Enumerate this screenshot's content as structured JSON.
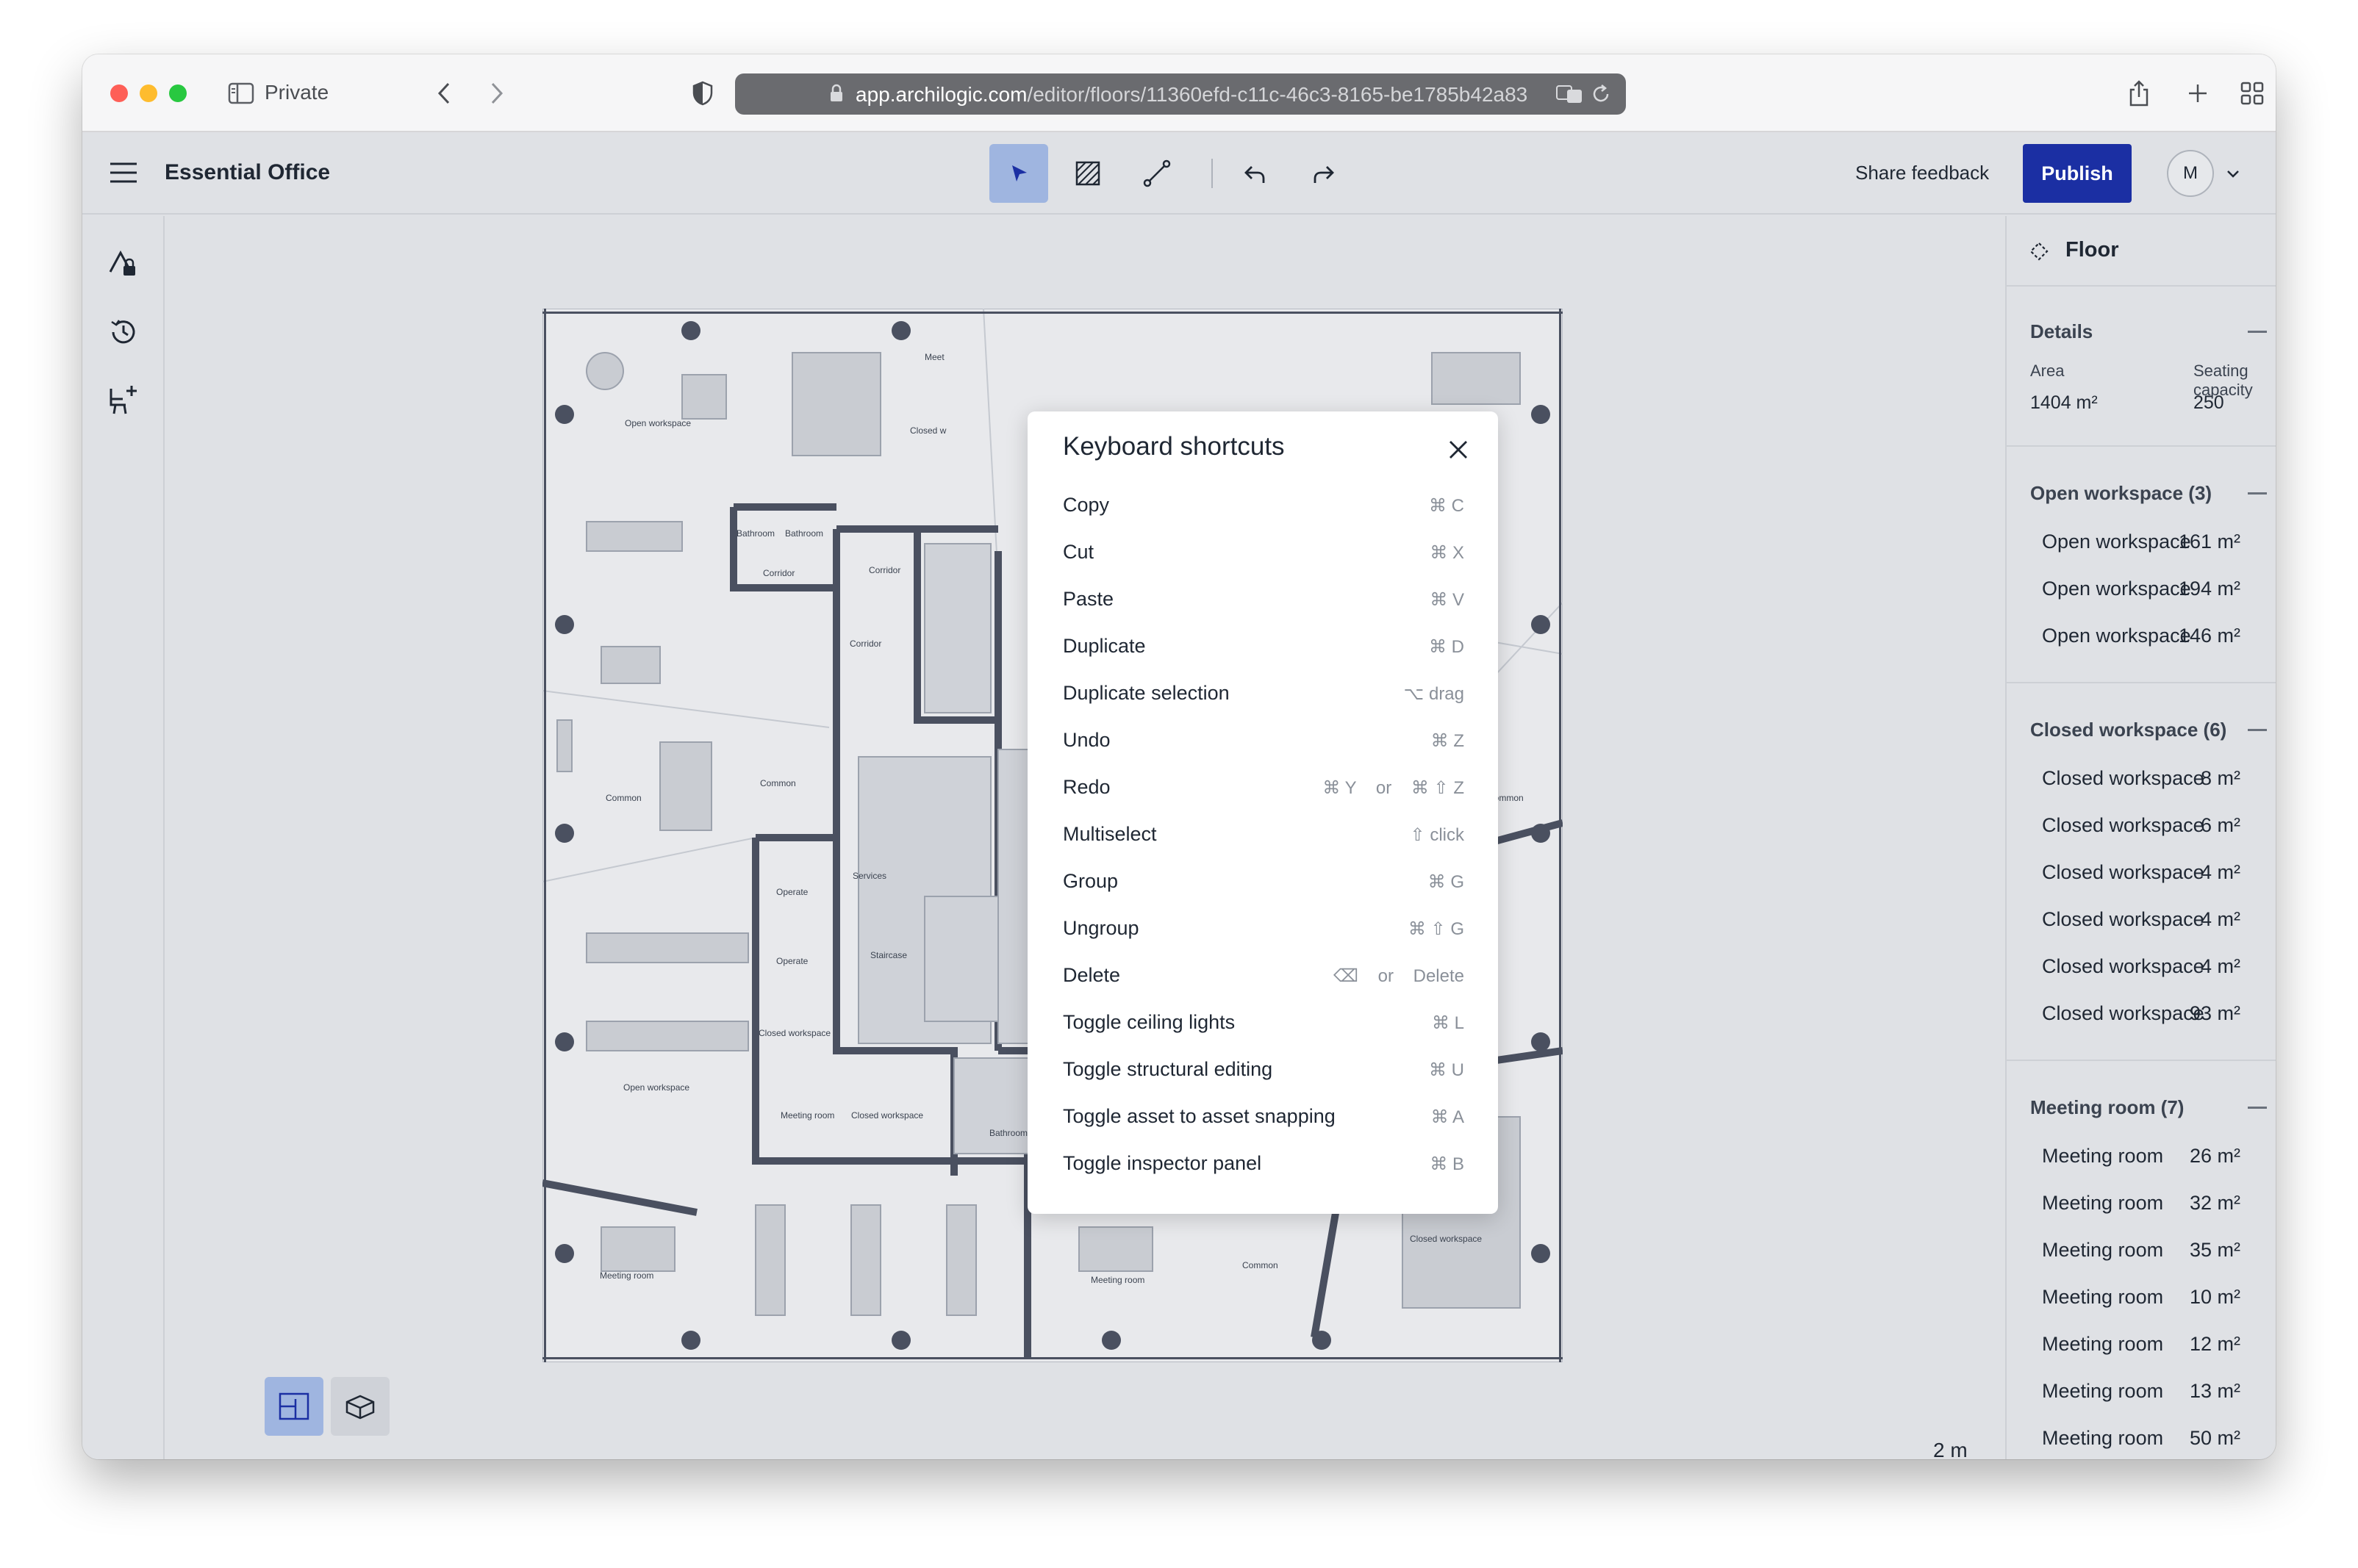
{
  "browser": {
    "private_label": "Private",
    "url_host": "app.archilogic.com",
    "url_path": "/editor/floors/11360efd-c11c-46c3-8165-be1785b42a83"
  },
  "app": {
    "title": "Essential Office",
    "share_feedback": "Share feedback",
    "publish": "Publish",
    "avatar_initial": "M"
  },
  "modal": {
    "title": "Keyboard shortcuts",
    "shortcuts": [
      {
        "label": "Copy",
        "keys": "⌘ C"
      },
      {
        "label": "Cut",
        "keys": "⌘ X"
      },
      {
        "label": "Paste",
        "keys": "⌘ V"
      },
      {
        "label": "Duplicate",
        "keys": "⌘ D"
      },
      {
        "label": "Duplicate selection",
        "keys": "⌥ drag"
      },
      {
        "label": "Undo",
        "keys": "⌘ Z"
      },
      {
        "label": "Redo",
        "keys": "⌘ Y    or    ⌘ ⇧ Z"
      },
      {
        "label": "Multiselect",
        "keys": "⇧ click"
      },
      {
        "label": "Group",
        "keys": "⌘ G"
      },
      {
        "label": "Ungroup",
        "keys": "⌘ ⇧ G"
      },
      {
        "label": "Delete",
        "keys": "⌫    or    Delete"
      },
      {
        "label": "Toggle ceiling lights",
        "keys": "⌘ L"
      },
      {
        "label": "Toggle structural editing",
        "keys": "⌘ U"
      },
      {
        "label": "Toggle asset to asset snapping",
        "keys": "⌘ A"
      },
      {
        "label": "Toggle inspector panel",
        "keys": "⌘ B"
      }
    ]
  },
  "panel": {
    "title": "Floor",
    "details": {
      "title": "Details",
      "area_label": "Area",
      "area_value": "1404 m²",
      "capacity_label": "Seating capacity",
      "capacity_value": "250"
    },
    "open": {
      "title": "Open workspace (3)",
      "items": [
        {
          "name": "Open workspace",
          "area": "161 m²"
        },
        {
          "name": "Open workspace",
          "area": "194 m²"
        },
        {
          "name": "Open workspace",
          "area": "146 m²"
        }
      ]
    },
    "closed": {
      "title": "Closed workspace (6)",
      "items": [
        {
          "name": "Closed workspace",
          "area": "8 m²"
        },
        {
          "name": "Closed workspace",
          "area": "6 m²"
        },
        {
          "name": "Closed workspace",
          "area": "4 m²"
        },
        {
          "name": "Closed workspace",
          "area": "4 m²"
        },
        {
          "name": "Closed workspace",
          "area": "4 m²"
        },
        {
          "name": "Closed workspace",
          "area": "93 m²"
        }
      ]
    },
    "meeting": {
      "title": "Meeting room (7)",
      "items": [
        {
          "name": "Meeting room",
          "area": "26 m²"
        },
        {
          "name": "Meeting room",
          "area": "32 m²"
        },
        {
          "name": "Meeting room",
          "area": "35 m²"
        },
        {
          "name": "Meeting room",
          "area": "10 m²"
        },
        {
          "name": "Meeting room",
          "area": "12 m²"
        },
        {
          "name": "Meeting room",
          "area": "13 m²"
        },
        {
          "name": "Meeting room",
          "area": "50 m²"
        }
      ]
    }
  },
  "floorplan": {
    "labels": {
      "open_workspace": "Open workspace",
      "common": "Common",
      "corridor": "Corridor",
      "bathroom": "Bathroom",
      "services": "Services",
      "staircase": "Staircase",
      "operate": "Operate",
      "closed_workspace": "Closed workspace",
      "meeting_room": "Meeting room",
      "meeting_cut": "Meet",
      "closed_cut": "Closed w",
      "workspace_cut": "orkspace"
    }
  },
  "scale": {
    "label": "2 m"
  },
  "colors": {
    "accent": "#1b2fa3",
    "active_tool": "#9fb5e0",
    "canvas": "#dfe1e5",
    "wall": "#4a5060"
  }
}
